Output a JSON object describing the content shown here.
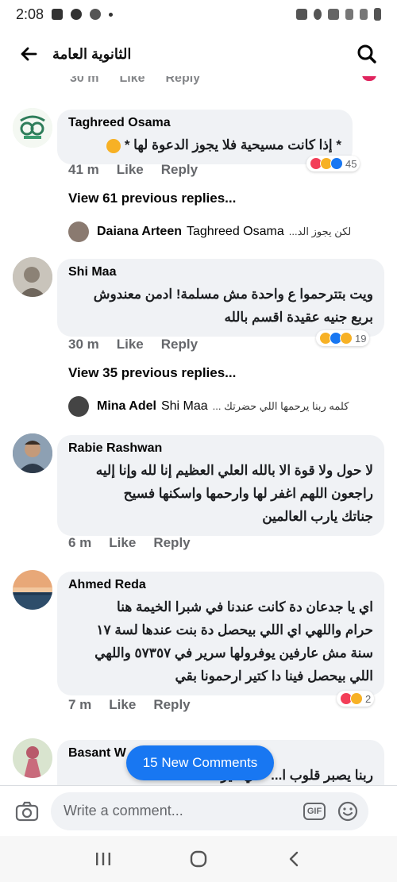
{
  "status_bar": {
    "time": "2:08"
  },
  "header": {
    "title": "الثانوية العامة"
  },
  "top_partial": {
    "time": "30 m",
    "like": "Like",
    "reply": "Reply"
  },
  "comments": [
    {
      "author": "Taghreed Osama",
      "text": "* إذا كانت مسيحية فلا يجوز الدعوة لها *",
      "time": "41 m",
      "like": "Like",
      "reply": "Reply",
      "reaction_count": "45",
      "view_replies": "View 61 previous replies...",
      "reply_preview": {
        "author": "Daiana Arteen",
        "mention": "Taghreed Osama",
        "snippet": "لكن يجوز الد..."
      }
    },
    {
      "author": "Shi Maa",
      "text": "ويت بتترحموا ع واحدة مش مسلمة! ادمن معندوش\nبربع جنيه عقيدة اقسم بالله",
      "time": "30 m",
      "like": "Like",
      "reply": "Reply",
      "reaction_count": "19",
      "view_replies": "View 35 previous replies...",
      "reply_preview": {
        "author": "Mina Adel",
        "mention": "Shi Maa",
        "snippet": "كلمه ربنا يرحمها اللي حضرتك ..."
      }
    },
    {
      "author": "Rabie Rashwan",
      "text": "لا حول ولا قوة الا بالله العلي العظيم إنا لله وإنا إليه\nراجعون اللهم اغفر لها وارحمها واسكنها فسيح\nجناتك يارب العالمين",
      "time": "6 m",
      "like": "Like",
      "reply": "Reply"
    },
    {
      "author": "Ahmed Reda",
      "text": "اي يا جدعان دة كانت عندنا في شبرا الخيمة هنا\nحرام واللهي اي اللي بيحصل دة بنت عندها لسة ١٧\nسنة مش عارفين يوفرولها سرير في ٥٧٣٥٧ واللهي\nاللي بيحصل فينا دا كتير ارحمونا بقي",
      "time": "7 m",
      "like": "Like",
      "reply": "Reply",
      "reaction_count": "2"
    },
    {
      "author": "Basant W",
      "text": "ربنا يصبر قلوب ا... علي غير"
    }
  ],
  "new_comments_pill": "15 New Comments",
  "composer": {
    "placeholder": "Write a comment...",
    "gif": "GIF"
  },
  "colors": {
    "accent": "#1877f2",
    "bubble": "#f0f2f5",
    "muted": "#65676b"
  }
}
